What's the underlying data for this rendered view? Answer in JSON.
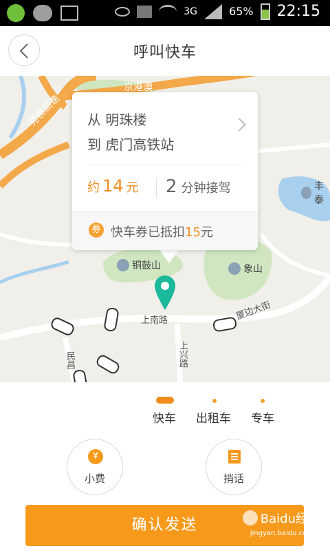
{
  "status_bar": {
    "network": "3G",
    "battery": "65%",
    "time": "22:15"
  },
  "header": {
    "title": "呼叫快车"
  },
  "map": {
    "labels": {
      "expressway_1": "京港澳",
      "expressway_2": "莞佛高速",
      "poi_tonggu": "铜鼓山",
      "poi_xiangshan": "象山",
      "poi_feng": "丰泰",
      "road_shangnan": "上南路",
      "road_xiabian": "厦边大街",
      "road_shangxing": "上兴路",
      "road_minchang": "民昌"
    }
  },
  "popup": {
    "from": "从 明珠楼",
    "to": "到 虎门高铁站",
    "fare_prefix": "约",
    "fare_value": "14",
    "fare_unit": "元",
    "eta_value": "2",
    "eta_text": "分钟接驾",
    "coupon_icon": "券",
    "coupon_text": "快车券已抵扣",
    "coupon_value": "15",
    "coupon_unit": "元"
  },
  "car_types": [
    {
      "label": "快车",
      "selected": true
    },
    {
      "label": "出租车",
      "selected": false
    },
    {
      "label": "专车",
      "selected": false
    }
  ],
  "actions": {
    "tip_label": "小费",
    "tip_icon_glyph": "¥",
    "message_label": "捎话",
    "confirm_label": "确认发送"
  },
  "watermark": {
    "brand": "Baidu经验",
    "url": "jingyan.baidu.com"
  },
  "colors": {
    "accent": "#f79a1c",
    "pin": "#1bb89a"
  }
}
